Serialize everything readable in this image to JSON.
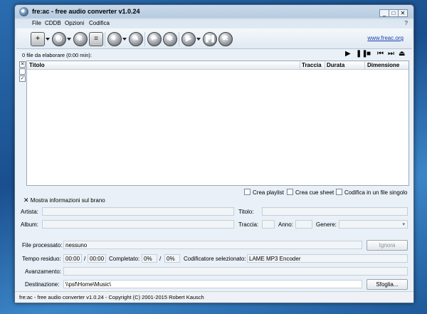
{
  "window": {
    "title": "fre:ac - free audio converter v1.0.24"
  },
  "menu": {
    "items": [
      "File",
      "CDDB",
      "Opzioni",
      "Codifica"
    ],
    "help": "?"
  },
  "toolbar": {
    "link": "www.freac.org"
  },
  "status": {
    "files": "0 file da elaborare (0:00 min):"
  },
  "list": {
    "columns": [
      "Titolo",
      "Traccia",
      "Durata",
      "Dimensione"
    ]
  },
  "options": {
    "playlist": "Crea playlist",
    "cuesheet": "Crea cue sheet",
    "single": "Codifica in un file singolo"
  },
  "info": {
    "toggle": "Mostra informazioni sul brano",
    "artist": "Artista:",
    "title": "Titolo:",
    "album": "Album:",
    "track": "Traccia:",
    "year": "Anno:",
    "genre": "Genere:"
  },
  "progress": {
    "processed_label": "File processato:",
    "processed_value": "nessuno",
    "skip_button": "Ignora",
    "remaining_label": "Tempo residuo:",
    "remaining_value": "00:00",
    "slash": "/",
    "total_value": "00:00",
    "completed_label": "Completato:",
    "completed_value": "0%",
    "completed_total": "0%",
    "encoder_label": "Codificatore selezionato:",
    "encoder_value": "LAME MP3 Encoder",
    "progress_label": "Avanzamento:",
    "dest_label": "Destinazione:",
    "dest_value": "\\\\psf\\Home\\Music\\",
    "browse_button": "Sfoglia..."
  },
  "footer": {
    "text": "fre:ac - free audio converter v1.0.24 - Copyright (C) 2001-2015 Robert Kausch"
  }
}
